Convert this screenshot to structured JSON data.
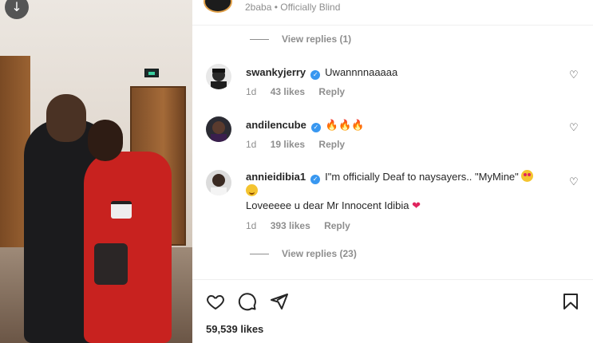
{
  "post": {
    "top_caption": "2baba • Officially Blind",
    "view_replies_first": "View replies (1)",
    "likes_total": "59,539 likes"
  },
  "comments": [
    {
      "username": "swankyjerry",
      "text": "Uwannnnaaaaa",
      "time": "1d",
      "likes": "43 likes",
      "reply": "Reply"
    },
    {
      "username": "andilencube",
      "text": "🔥🔥🔥",
      "time": "1d",
      "likes": "19 likes",
      "reply": "Reply"
    },
    {
      "username": "annieidibia1",
      "text": "I\"m officially Deaf to naysayers.. \"MyMine\"",
      "text_line2": "Loveeeee u dear Mr Innocent Idibia",
      "time": "1d",
      "likes": "393 likes",
      "reply": "Reply",
      "view_replies": "View replies (23)"
    }
  ],
  "icons": {
    "download": "download-icon",
    "heart": "heart-icon",
    "comment": "comment-icon",
    "share": "share-icon",
    "bookmark": "bookmark-icon"
  },
  "colors": {
    "verified": "#3897f0",
    "muted": "#8e8e8e",
    "text": "#262626"
  }
}
